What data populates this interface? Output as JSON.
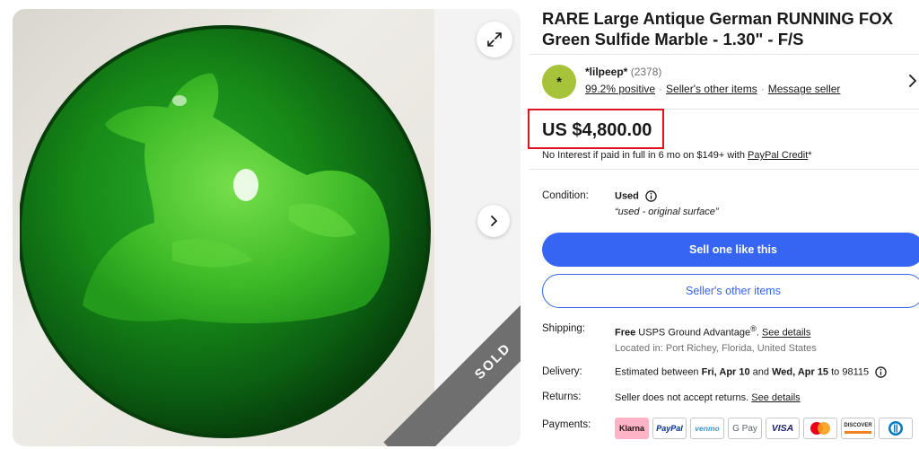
{
  "listing": {
    "title": "RARE Large Antique German RUNNING FOX Green Sulfide Marble - 1.30\" - F/S",
    "sold_badge": "SOLD"
  },
  "seller": {
    "avatar_letter": "*",
    "name": "*lilpeep*",
    "feedback_count": "(2378)",
    "positive": "99.2% positive",
    "other_items": "Seller's other items",
    "message": "Message seller"
  },
  "price": {
    "amount": "US $4,800.00",
    "financing_text": "No Interest if paid in full in 6 mo on $149+ with ",
    "financing_link": "PayPal Credit",
    "financing_suffix": "*"
  },
  "condition": {
    "label": "Condition:",
    "value": "Used",
    "note": "“used - original surface”"
  },
  "actions": {
    "sell_one": "Sell one like this",
    "seller_items": "Seller's other items"
  },
  "shipping": {
    "label": "Shipping:",
    "free": "Free",
    "service": " USPS Ground Advantage",
    "registered": "®",
    "details_link": "See details",
    "location": "Located in: Port Richey, Florida, United States"
  },
  "delivery": {
    "label": "Delivery:",
    "prefix": "Estimated between ",
    "start": "Fri, Apr 10",
    "and": " and ",
    "end": "Wed, Apr 15",
    "to": " to 98115"
  },
  "returns": {
    "label": "Returns:",
    "text": "Seller does not accept returns. ",
    "details_link": "See details"
  },
  "payments": {
    "label": "Payments:",
    "methods": [
      "Klarna",
      "PayPal",
      "venmo",
      "G Pay",
      "VISA",
      "Mastercard",
      "DISCOVER",
      "Diners Club"
    ]
  },
  "colors": {
    "primary_button": "#3665f3",
    "highlight_box": "#e0141e",
    "marble_green": "#1f8a1f",
    "sold_ribbon": "#6f6f6f"
  },
  "icons": [
    "expand-icon",
    "chevron-right-icon",
    "info-icon"
  ]
}
